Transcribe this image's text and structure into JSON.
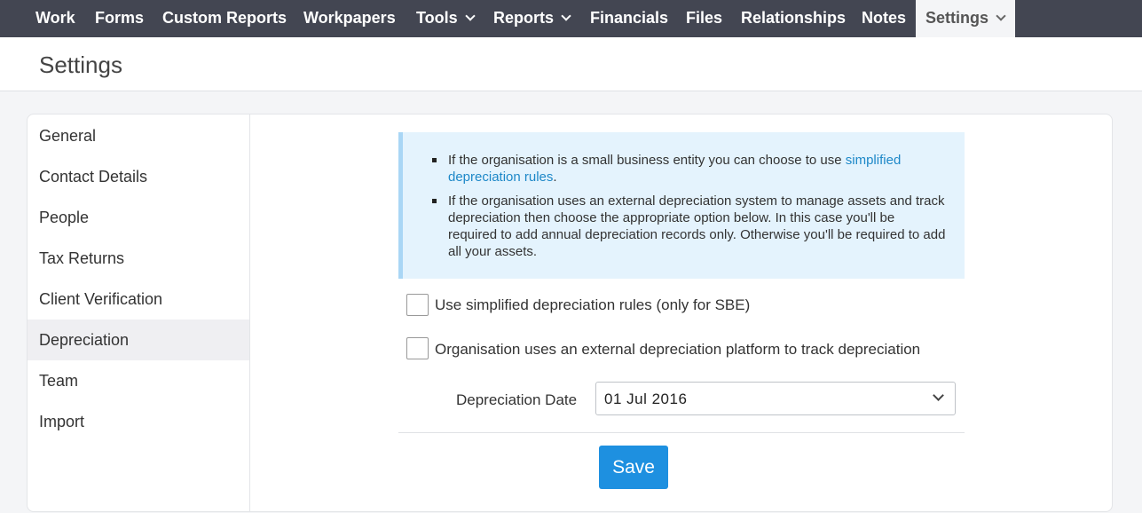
{
  "nav": {
    "items": [
      {
        "label": "Work"
      },
      {
        "label": "Forms"
      },
      {
        "label": "Custom Reports"
      },
      {
        "label": "Workpapers"
      },
      {
        "label": "Tools"
      },
      {
        "label": "Reports"
      },
      {
        "label": "Financials"
      },
      {
        "label": "Files"
      },
      {
        "label": "Relationships"
      },
      {
        "label": "Notes"
      },
      {
        "label": "Settings"
      }
    ],
    "active": "Settings"
  },
  "page": {
    "title": "Settings"
  },
  "sidebar": {
    "items": [
      {
        "label": "General"
      },
      {
        "label": "Contact Details"
      },
      {
        "label": "People"
      },
      {
        "label": "Tax Returns"
      },
      {
        "label": "Client Verification"
      },
      {
        "label": "Depreciation"
      },
      {
        "label": "Team"
      },
      {
        "label": "Import"
      }
    ],
    "active": "Depreciation"
  },
  "info": {
    "bullet1_text": "If the organisation is a small business entity you can choose to use ",
    "bullet1_link": "simplified depreciation rules",
    "bullet1_end": ".",
    "bullet2_text": "If the organisation uses an external depreciation system to manage assets and track depreciation then choose the appropriate option below. In this case you'll be required to add annual depreciation records only. Otherwise you'll be required to add all your assets."
  },
  "options": {
    "simplified_label": "Use simplified depreciation rules (only for SBE)",
    "simplified_checked": false,
    "external_label": "Organisation uses an external depreciation platform to track depreciation",
    "external_checked": false
  },
  "depreciation_date": {
    "label": "Depreciation Date",
    "value": "01 Jul 2016"
  },
  "actions": {
    "save_label": "Save"
  },
  "colors": {
    "nav_bg": "#434652",
    "accent": "#1e90e0",
    "link": "#1e88c8",
    "info_bg": "#e4f3fd"
  }
}
